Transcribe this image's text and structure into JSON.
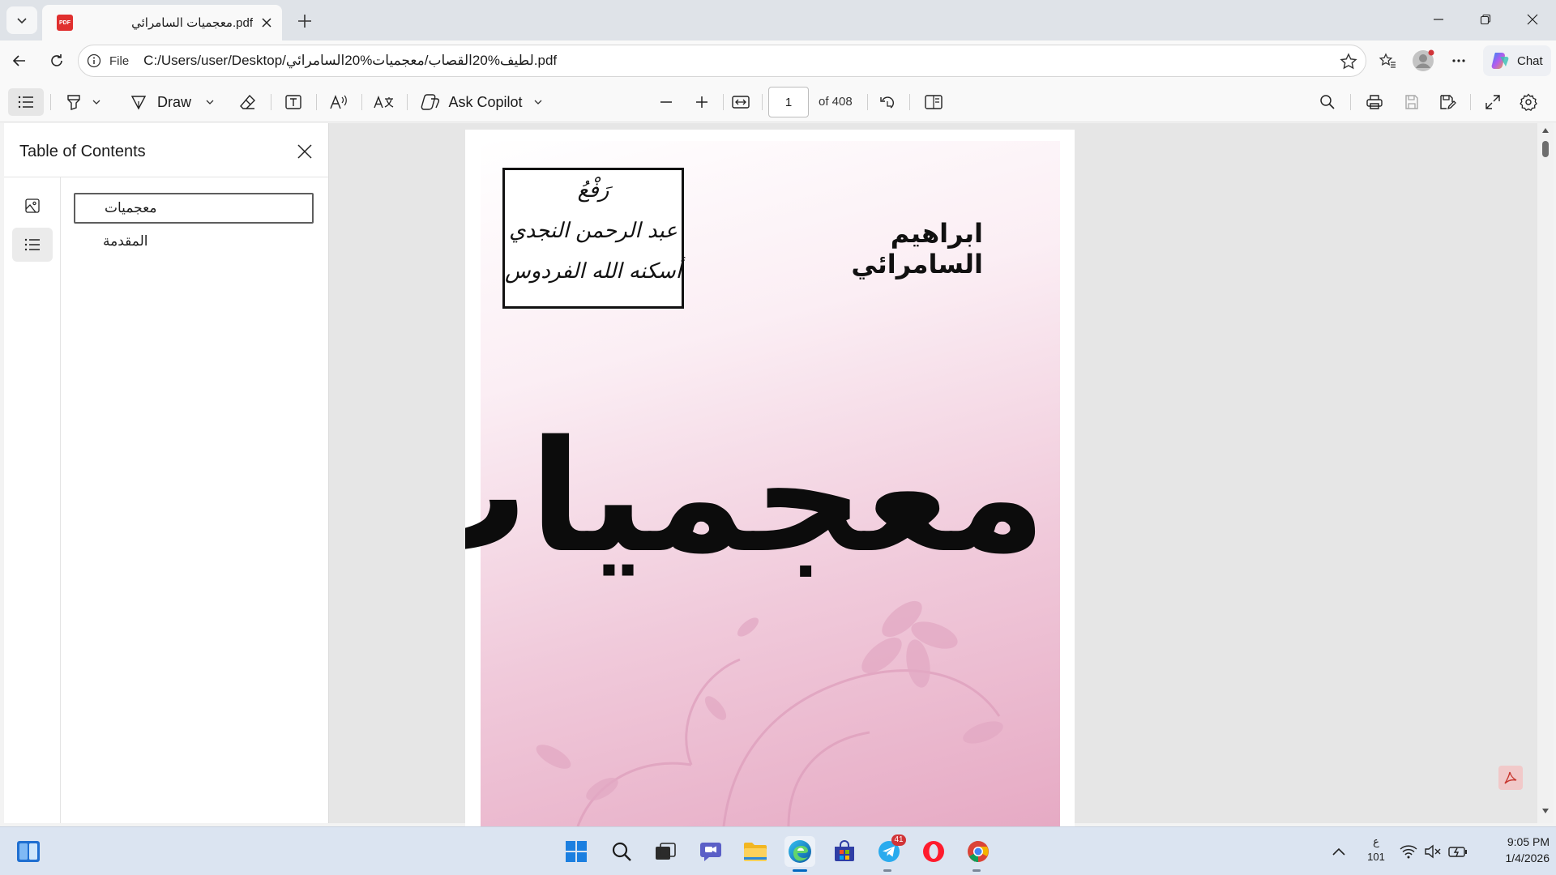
{
  "browser": {
    "tab_title": "معجميات السامرائي.pdf",
    "pdf_badge": "PDF",
    "address": {
      "file_label": "File",
      "url": "C:/Users/user/Desktop/لطيف%20القصاب/معجميات%20السامرائي.pdf"
    },
    "chat_label": "Chat"
  },
  "pdf_toolbar": {
    "draw_label": "Draw",
    "ask_copilot_label": "Ask Copilot",
    "page_current": "1",
    "page_total_label": "of 408"
  },
  "sidebar": {
    "title": "Table of Contents",
    "toc_items": [
      {
        "label": "معجميات",
        "selected": true
      },
      {
        "label": "المقدمة",
        "selected": false
      }
    ]
  },
  "document": {
    "stamp_lines": [
      "رَفْعُ",
      "عبد الرحمن النجدي",
      "أسكنه الله الفردوس"
    ],
    "author": "ابراهيم السامرائي",
    "title": "معجميات"
  },
  "taskbar": {
    "telegram_badge": "41",
    "lang_top": "ع",
    "lang_bottom": "101",
    "time": "9:05 PM",
    "date": "1/4/2026"
  },
  "colors": {
    "accent": "#0067c0",
    "pdf_red": "#e0302f",
    "cover_pink": "#e6aac4"
  }
}
